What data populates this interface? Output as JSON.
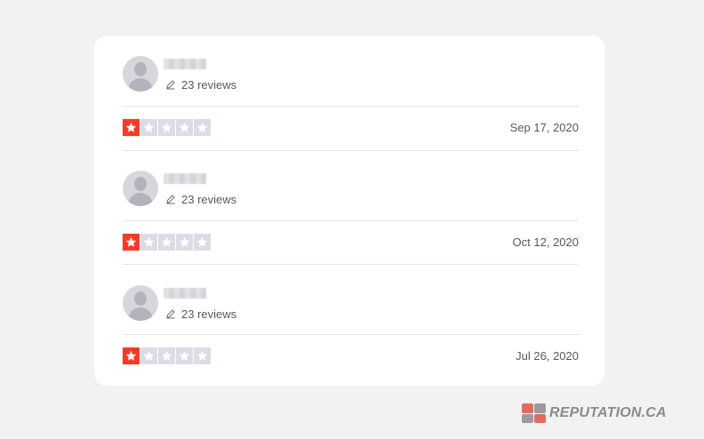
{
  "reviews": [
    {
      "review_count": "23 reviews",
      "rating": 1,
      "max_rating": 5,
      "date": "Sep 17, 2020"
    },
    {
      "review_count": "23 reviews",
      "rating": 1,
      "max_rating": 5,
      "date": "Oct 12, 2020"
    },
    {
      "review_count": "23 reviews",
      "rating": 1,
      "max_rating": 5,
      "date": "Jul 26, 2020"
    }
  ],
  "colors": {
    "star_filled": "#ff3722",
    "star_empty": "#dcdce6",
    "background": "#f2f2f2",
    "card": "#ffffff"
  },
  "watermark": {
    "text": "REPUTATION.CA"
  }
}
